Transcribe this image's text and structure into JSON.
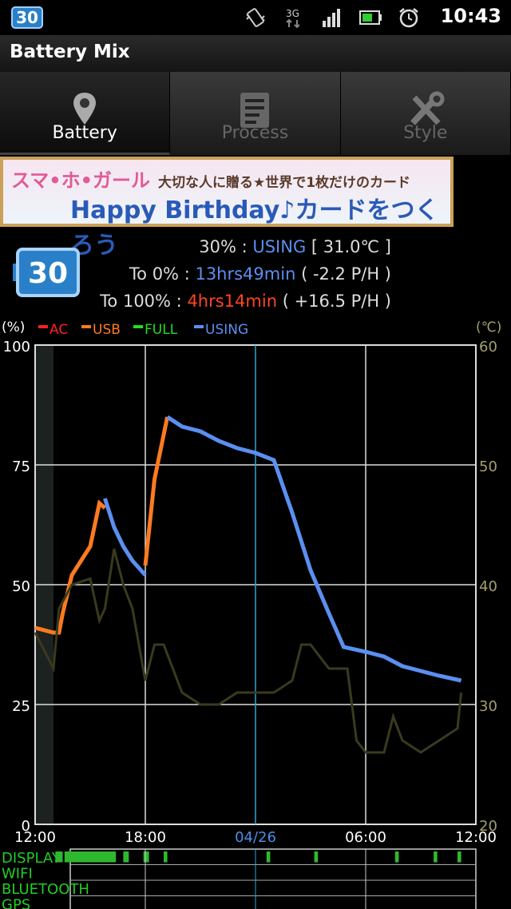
{
  "status_bar": {
    "badge": "30",
    "network": "3G",
    "time": "10:43",
    "icons": [
      "vibrate-icon",
      "network-3g-icon",
      "signal-icon",
      "battery-icon",
      "alarm-icon"
    ]
  },
  "app": {
    "title": "Battery Mix"
  },
  "tabs": [
    {
      "label": "Battery",
      "icon": "pin-icon",
      "active": true
    },
    {
      "label": "Process",
      "icon": "checklist-icon",
      "active": false
    },
    {
      "label": "Style",
      "icon": "tools-icon",
      "active": false
    }
  ],
  "ad": {
    "line1": "スマ•ホ•ガール",
    "line1_small": "大切な人に贈る★世界で1枚だけのカード",
    "line2": "Happy Birthday♪カードをつくろう"
  },
  "battery_info": {
    "badge": "30",
    "level_label": "30%",
    "level_state": "USING",
    "level_temp": "[ 31.0℃ ]",
    "to_zero_label": "To 0%",
    "to_zero_time": "13hrs49min",
    "to_zero_rate": "( -2.2 P/H )",
    "to_full_label": "To 100%",
    "to_full_time": "4hrs14min",
    "to_full_rate": "( +16.5 P/H )"
  },
  "colors": {
    "ac": "#ff2020",
    "usb": "#ff7a20",
    "full": "#22dd22",
    "using": "#5b8ff0",
    "temp": "#3a3a1e",
    "accent": "#2a80c8"
  },
  "chart_data": {
    "type": "line",
    "y_left_label": "(%)",
    "y_right_label": "(℃)",
    "legend": [
      "AC",
      "USB",
      "FULL",
      "USING"
    ],
    "y_left_ticks": [
      "100",
      "75",
      "50",
      "25",
      "0"
    ],
    "y_right_ticks": [
      "60",
      "50",
      "40",
      "30",
      "20"
    ],
    "x_ticks": [
      "12:00",
      "18:00",
      "04/26",
      "06:00",
      "12:00"
    ],
    "ylim_left": [
      0,
      100
    ],
    "ylim_right": [
      20,
      60
    ],
    "xlim_hours": [
      0,
      24
    ],
    "gap_region_hours": [
      0,
      1
    ],
    "series": [
      {
        "name": "AC",
        "values": []
      },
      {
        "name": "USB",
        "points": [
          [
            0,
            41
          ],
          [
            1,
            40
          ],
          [
            1.3,
            40
          ],
          [
            1.5,
            44
          ],
          [
            2.0,
            52
          ],
          [
            2.5,
            55
          ],
          [
            3.0,
            58
          ],
          [
            3.5,
            67
          ],
          [
            3.8,
            66
          ]
        ]
      },
      {
        "name": "USB",
        "points": [
          [
            6.0,
            54
          ],
          [
            6.5,
            72
          ],
          [
            7.2,
            85
          ]
        ]
      },
      {
        "name": "USING",
        "points": [
          [
            3.8,
            68
          ],
          [
            4.3,
            62
          ],
          [
            4.8,
            58
          ],
          [
            5.3,
            55
          ],
          [
            6.0,
            52
          ]
        ]
      },
      {
        "name": "USING",
        "points": [
          [
            7.2,
            85
          ],
          [
            8,
            83
          ],
          [
            9,
            82
          ],
          [
            10,
            80
          ],
          [
            11,
            78.5
          ],
          [
            12,
            77.5
          ],
          [
            13,
            76
          ],
          [
            14,
            65
          ],
          [
            15,
            53
          ],
          [
            16,
            44
          ],
          [
            16.8,
            37
          ],
          [
            18,
            36
          ],
          [
            19,
            35
          ],
          [
            20,
            33
          ],
          [
            21,
            32
          ],
          [
            22,
            31
          ],
          [
            23.2,
            30
          ]
        ]
      },
      {
        "name": "Temperature",
        "points": [
          [
            0,
            36
          ],
          [
            1,
            33
          ],
          [
            1.3,
            38
          ],
          [
            2,
            40
          ],
          [
            3,
            40.5
          ],
          [
            3.5,
            37
          ],
          [
            3.8,
            38
          ],
          [
            4.3,
            43
          ],
          [
            4.8,
            40
          ],
          [
            5.3,
            38
          ],
          [
            6,
            32
          ],
          [
            6.5,
            35
          ],
          [
            7,
            35
          ],
          [
            8,
            31
          ],
          [
            9,
            30
          ],
          [
            10,
            30
          ],
          [
            11,
            31
          ],
          [
            12,
            31
          ],
          [
            13,
            31
          ],
          [
            14,
            32
          ],
          [
            14.5,
            35
          ],
          [
            15,
            35
          ],
          [
            16,
            33
          ],
          [
            17,
            33
          ],
          [
            17.5,
            27
          ],
          [
            18,
            26
          ],
          [
            19,
            26
          ],
          [
            19.5,
            29
          ],
          [
            20,
            27
          ],
          [
            21,
            26
          ],
          [
            22,
            27
          ],
          [
            23,
            28
          ],
          [
            23.2,
            31
          ]
        ]
      }
    ],
    "activity_rows": [
      {
        "name": "DISPLAY",
        "segments_hours": [
          [
            1.1,
            1.5
          ],
          [
            1.6,
            4.4
          ],
          [
            4.8,
            5.1
          ],
          [
            5.9,
            6.2
          ],
          [
            7.0,
            7.2
          ],
          [
            12.6,
            12.8
          ],
          [
            15.2,
            15.4
          ],
          [
            19.6,
            19.8
          ],
          [
            21.7,
            21.9
          ],
          [
            23.0,
            23.2
          ]
        ]
      },
      {
        "name": "WIFI",
        "segments_hours": []
      },
      {
        "name": "BLUETOOTH",
        "segments_hours": []
      },
      {
        "name": "GPS",
        "segments_hours": []
      }
    ]
  }
}
